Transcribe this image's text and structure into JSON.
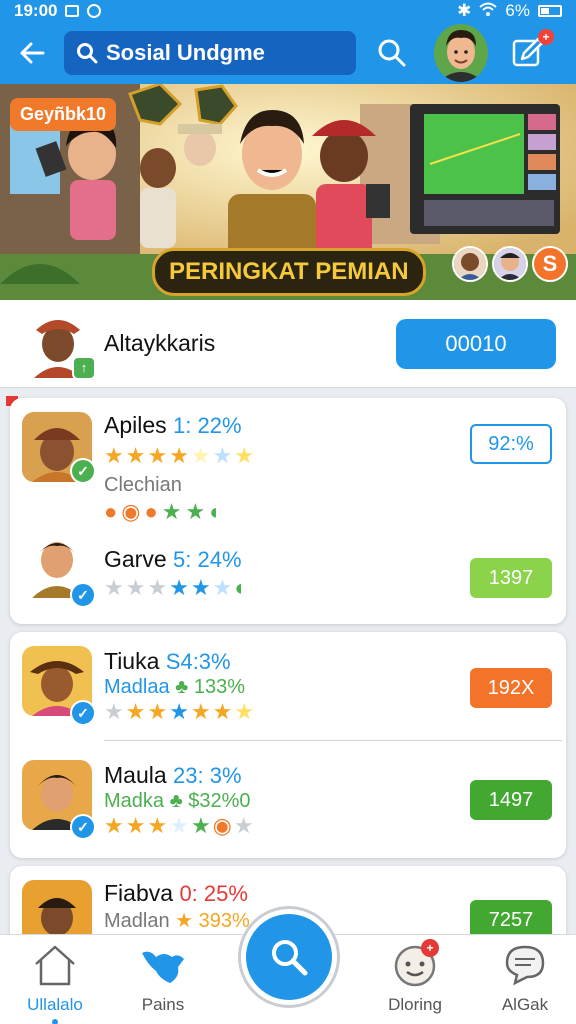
{
  "status_bar": {
    "time": "19:00",
    "battery": "6%"
  },
  "app_bar": {
    "title": "Sosial Undgme",
    "notification_count": "+"
  },
  "banner": {
    "tag": "Geyñbk10",
    "title": "PERINGKAT PEMIAN",
    "badge_glyph": "S"
  },
  "me": {
    "name": "Altaykkaris",
    "score": "00010",
    "badge": "↑"
  },
  "leaderboard": [
    {
      "name": "Apiles",
      "stat": "1: 22%",
      "stat_color": "#2196e8",
      "sub": "Clechian",
      "sub_color": "#777777",
      "stars1": [
        "#f5a623",
        "#f5a623",
        "#f5a623",
        "#f5a623",
        "#fff3b0",
        "#bfe0ff",
        "#ffe066"
      ],
      "stars2": [
        "#f07a2a",
        "#f07a2a",
        "#f07a2a",
        "#4caf50",
        "#4caf50",
        "#4caf50"
      ],
      "score": "92:%",
      "score_style": "outline"
    },
    {
      "name": "Garve",
      "stat": "5: 24%",
      "stat_color": "#2196e8",
      "stars1": [
        "#c9ced4",
        "#c9ced4",
        "#c9ced4",
        "#2196e8",
        "#2196e8",
        "#bfe0ff",
        "#4caf50"
      ],
      "score": "1397",
      "score_style": "lime"
    },
    {
      "name": "Tiuka",
      "stat": "S4:3%",
      "stat_color": "#2196e8",
      "sub": "Madlaa",
      "sub_color": "#2196e8",
      "sub_stat": "133%",
      "sub_stat_color": "#4caf50",
      "stars1": [
        "#c9ced4",
        "#f5a623",
        "#f5a623",
        "#2196e8",
        "#f5a623",
        "#f5a623",
        "#ffe066"
      ],
      "score": "192X",
      "score_style": "orange"
    },
    {
      "name": "Maula",
      "stat": "23: 3%",
      "stat_color": "#2196e8",
      "sub": "Madka",
      "sub_color": "#4caf50",
      "sub_stat": "$32%0",
      "sub_stat_color": "#4caf50",
      "stars1": [
        "#f5a623",
        "#f5a623",
        "#f5a623",
        "#bfe0ff",
        "#4caf50",
        "#f07a2a",
        "#c9ced4"
      ],
      "score": "1497",
      "score_style": "green"
    },
    {
      "name": "Fiabva",
      "stat": "0: 25%",
      "stat_color": "#e53935",
      "sub": "Madlan",
      "sub_color": "#777777",
      "sub_stat": "393%",
      "sub_stat_color": "#f5a623",
      "score": "7257",
      "score_style": "green"
    }
  ],
  "bottom_nav": [
    {
      "label": "Ullalalo",
      "icon": "home-icon",
      "active": true
    },
    {
      "label": "Pains",
      "icon": "bird-icon"
    },
    {
      "label": "Dloring",
      "icon": "face-icon",
      "badge": "+"
    },
    {
      "label": "AlGak",
      "icon": "chat-icon"
    }
  ],
  "colors": {
    "primary": "#2196e8",
    "primary_dark": "#1565c0",
    "green": "#4caf50",
    "orange": "#f27329",
    "lime": "#8bd34a"
  }
}
